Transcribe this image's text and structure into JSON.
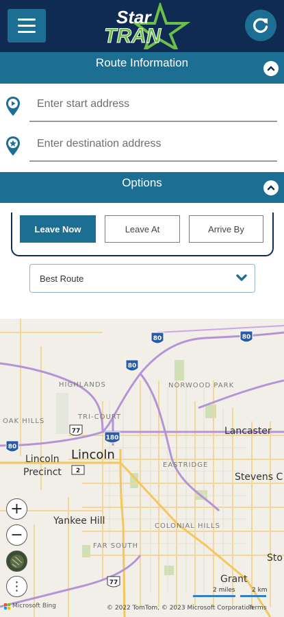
{
  "header": {
    "menu_icon": "hamburger-icon",
    "logo_text_top": "Star",
    "logo_text_bottom": "TRAN",
    "refresh_icon": "refresh-icon"
  },
  "route_info": {
    "title": "Route Information",
    "start_placeholder": "Enter start address",
    "destination_placeholder": "Enter destination address"
  },
  "options": {
    "title": "Options",
    "leave_now": "Leave Now",
    "leave_at": "Leave At",
    "arrive_by": "Arrive By",
    "route_type": "Best Route"
  },
  "map": {
    "labels": {
      "highlands": "HIGHLANDS",
      "norwood_park": "NORWOOD PARK",
      "oak_hills": "OAK HILLS",
      "tri_court": "TRI-COURT",
      "lancaster": "Lancaster",
      "lincoln_precinct_1": "Lincoln",
      "lincoln_precinct_2": "Precinct",
      "lincoln": "Lincoln",
      "eastridge": "EASTRIDGE",
      "stevens_creek": "Stevens C",
      "yankee_hill": "Yankee Hill",
      "colonial_hills": "COLONIAL HILLS",
      "far_south": "FAR SOUTH",
      "stockton": "Sto",
      "grant": "Grant"
    },
    "shields": {
      "i80_a": "80",
      "i80_b": "80",
      "i80_c": "80",
      "i80_d": "80",
      "i180": "180",
      "us77_a": "77",
      "us77_b": "77",
      "ne2": "2"
    },
    "scale_miles": "2 miles",
    "scale_km": "2 km",
    "provider": "Microsoft Bing",
    "copyright": "© 2022 TomTom, © 2023 Microsoft Corporation",
    "terms": "Terms",
    "controls": {
      "zoom_in": "+",
      "zoom_out": "−",
      "more": "⋮"
    }
  }
}
